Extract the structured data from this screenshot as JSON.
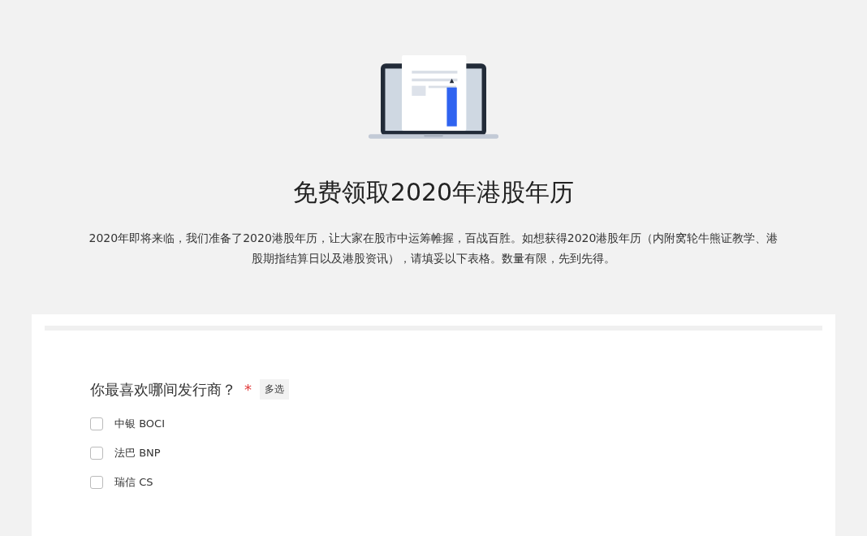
{
  "header": {
    "title": "免费领取2020年港股年历",
    "description": "2020年即将来临，我们准备了2020港股年历，让大家在股市中运筹帷握，百战百胜。如想获得2020港股年历（内附窝轮牛熊证教学、港股期指结算日以及港股资讯），请填妥以下表格。数量有限，先到先得。"
  },
  "form": {
    "question": {
      "label": "你最喜欢哪间发行商？",
      "required_mark": "*",
      "tag": "多选",
      "options": [
        {
          "label": "中银 BOCI",
          "checked": false
        },
        {
          "label": "法巴 BNP",
          "checked": false
        },
        {
          "label": "瑞信 CS",
          "checked": false
        }
      ]
    }
  }
}
